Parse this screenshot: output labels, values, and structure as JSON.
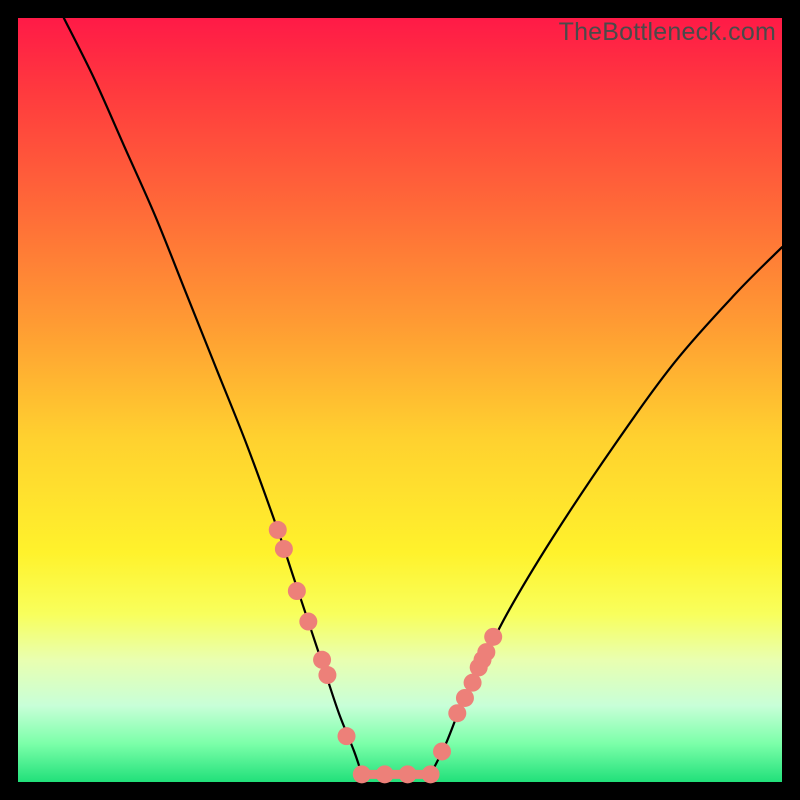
{
  "watermark": "TheBottleneck.com",
  "colors": {
    "dot": "#ed8079",
    "curve": "#000000"
  },
  "chart_data": {
    "type": "line",
    "title": "",
    "xlabel": "",
    "ylabel": "",
    "xlim": [
      0,
      100
    ],
    "ylim": [
      0,
      100
    ],
    "series": [
      {
        "name": "left-curve",
        "x": [
          6,
          10,
          14,
          18,
          22,
          26,
          30,
          34,
          36,
          38,
          40,
          42,
          44,
          45
        ],
        "y": [
          100,
          92,
          83,
          74,
          64,
          54,
          44,
          33,
          27,
          21,
          15,
          9,
          4,
          1
        ]
      },
      {
        "name": "flat-min",
        "x": [
          45,
          54
        ],
        "y": [
          1,
          1
        ]
      },
      {
        "name": "right-curve",
        "x": [
          54,
          56,
          58,
          60,
          64,
          70,
          78,
          86,
          94,
          100
        ],
        "y": [
          1,
          5,
          10,
          14,
          22,
          32,
          44,
          55,
          64,
          70
        ]
      }
    ],
    "points": {
      "name": "markers",
      "x": [
        34.0,
        34.8,
        36.5,
        38.0,
        39.8,
        40.5,
        43.0,
        45.0,
        48.0,
        51.0,
        54.0,
        55.5,
        57.5,
        58.5,
        59.5,
        60.3,
        60.8,
        61.3,
        62.2
      ],
      "y": [
        33.0,
        30.5,
        25.0,
        21.0,
        16.0,
        14.0,
        6.0,
        1.0,
        1.0,
        1.0,
        1.0,
        4.0,
        9.0,
        11.0,
        13.0,
        15.0,
        16.0,
        17.0,
        19.0
      ]
    }
  }
}
